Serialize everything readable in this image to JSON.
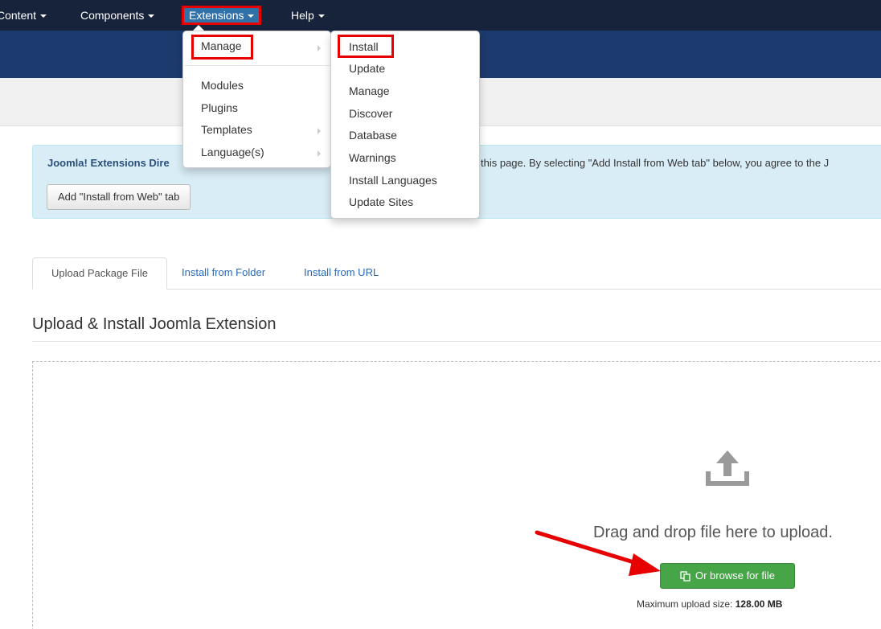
{
  "nav": {
    "items": [
      {
        "label": "Content"
      },
      {
        "label": "Components"
      },
      {
        "label": "Extensions"
      },
      {
        "label": "Help"
      }
    ]
  },
  "extensions_menu": {
    "items": [
      {
        "label": "Manage"
      },
      {
        "label": "Modules"
      },
      {
        "label": "Plugins"
      },
      {
        "label": "Templates"
      },
      {
        "label": "Language(s)"
      }
    ]
  },
  "manage_submenu": {
    "items": [
      {
        "label": "Install"
      },
      {
        "label": "Update"
      },
      {
        "label": "Manage"
      },
      {
        "label": "Discover"
      },
      {
        "label": "Database"
      },
      {
        "label": "Warnings"
      },
      {
        "label": "Install Languages"
      },
      {
        "label": "Update Sites"
      }
    ]
  },
  "alert": {
    "bold_text": "Joomla! Extensions Dire",
    "trailing_text": "this page. By selecting \"Add Install from Web tab\" below, you agree to the J",
    "button_label": "Add \"Install from Web\" tab"
  },
  "tabs": [
    {
      "label": "Upload Package File"
    },
    {
      "label": "Install from Folder"
    },
    {
      "label": "Install from URL"
    }
  ],
  "upload": {
    "title": "Upload & Install Joomla Extension",
    "drag_text": "Drag and drop file here to upload.",
    "browse_label": "Or browse for file",
    "max_size_label": "Maximum upload size:",
    "max_size_value": "128.00 MB"
  },
  "colors": {
    "topnav_bg": "#17233a",
    "header_band": "#1d3a6e",
    "highlight_red": "#e60000",
    "browse_green": "#46a546",
    "alert_bg": "#d9edf7"
  }
}
